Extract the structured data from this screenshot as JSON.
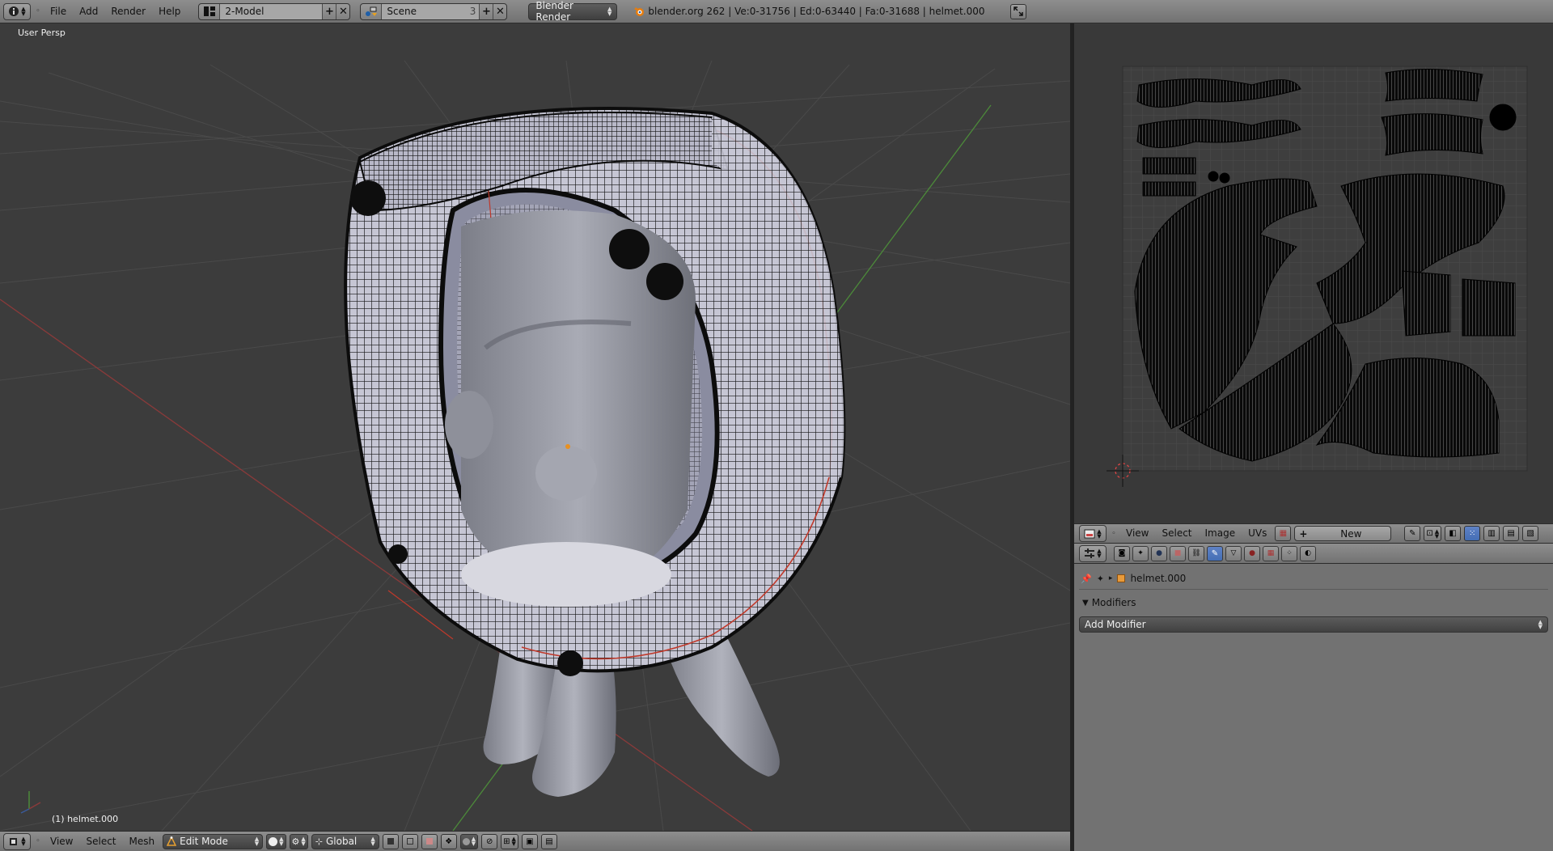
{
  "topbar": {
    "menus": [
      "File",
      "Add",
      "Render",
      "Help"
    ],
    "screen_layout": "2-Model",
    "scene": "Scene",
    "scene_users": "3",
    "render_engine": "Blender Render",
    "stats": "blender.org 262 | Ve:0-31756 | Ed:0-63440 | Fa:0-31688 | helmet.000"
  },
  "viewport": {
    "view_label": "User Persp",
    "object_label": "(1) helmet.000",
    "header": {
      "menus": [
        "View",
        "Select",
        "Mesh"
      ],
      "mode": "Edit Mode",
      "orientation": "Global"
    }
  },
  "uv_editor": {
    "menus": [
      "View",
      "Select",
      "Image",
      "UVs"
    ],
    "new_label": "New"
  },
  "properties": {
    "object_name": "helmet.000",
    "panel_title": "Modifiers",
    "add_modifier": "Add Modifier"
  },
  "colors": {
    "header_bg": "#808080",
    "viewport_bg": "#3c3c3c",
    "grid_line": "#474747",
    "x_axis": "#8a3a3a",
    "y_axis": "#4c8a3a",
    "wire": "#111111",
    "seam": "#c0392b",
    "active_tab": "#5a7fc4"
  }
}
